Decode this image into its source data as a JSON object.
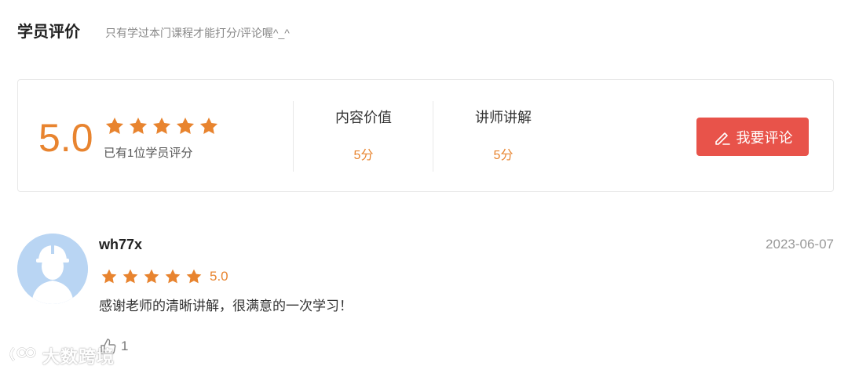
{
  "header": {
    "title": "学员评价",
    "subtitle": "只有学过本门课程才能打分/评论喔^_^"
  },
  "summary": {
    "score": "5.0",
    "rating": 5,
    "rating_max": 5,
    "count_text": "已有1位学员评分",
    "dimensions": [
      {
        "label": "内容价值",
        "value": "5分"
      },
      {
        "label": "讲师讲解",
        "value": "5分"
      }
    ],
    "review_button": "我要评论"
  },
  "reviews": [
    {
      "username": "wh77x",
      "date": "2023-06-07",
      "rating": 5,
      "score": "5.0",
      "comment": "感谢老师的清晰讲解，很满意的一次学习！",
      "likes": "1"
    }
  ],
  "watermark": {
    "text": "大数跨境"
  },
  "colors": {
    "accent": "#e8842f",
    "button": "#e8534a",
    "star": "#e8842f"
  }
}
